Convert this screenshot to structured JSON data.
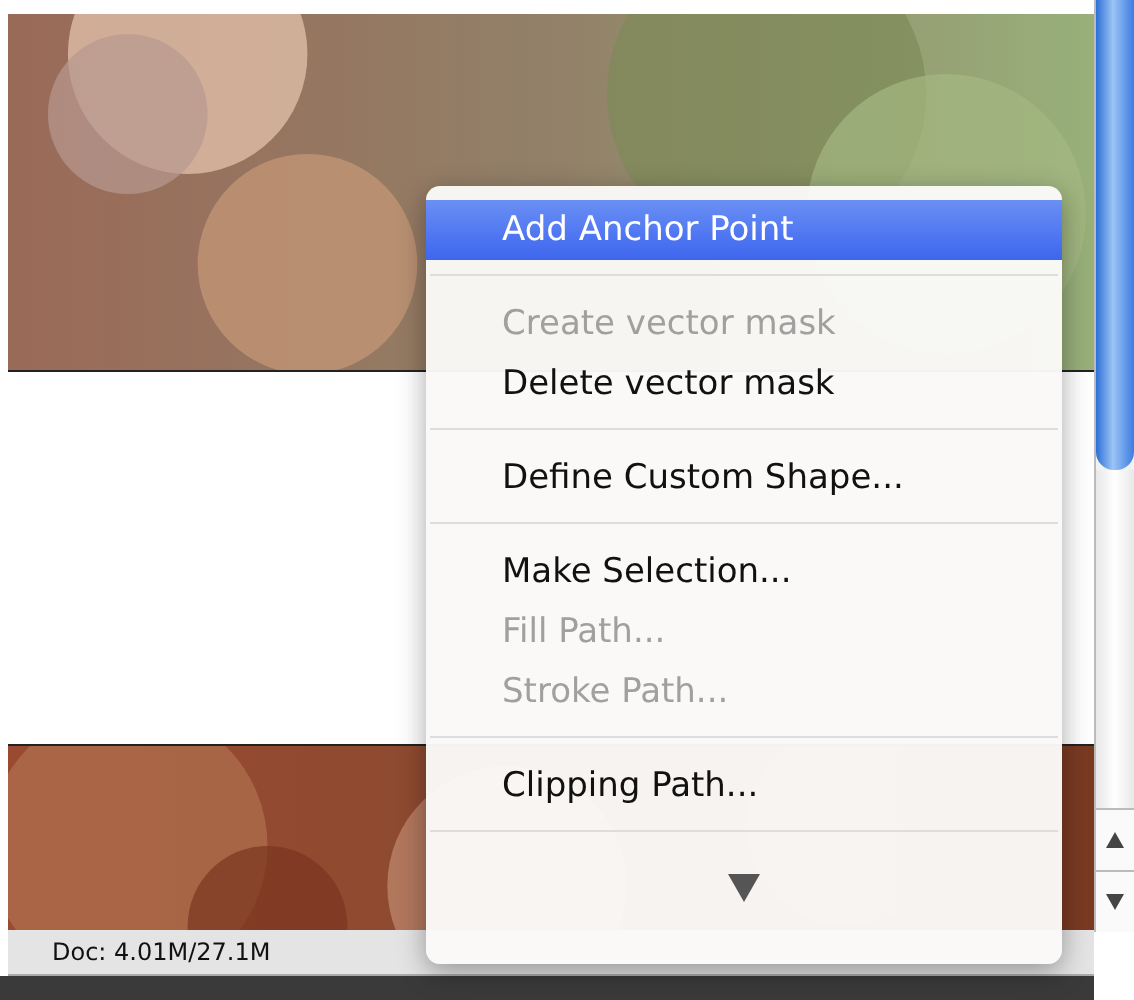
{
  "context_menu": {
    "items": [
      {
        "kind": "item",
        "label": "Add Anchor Point",
        "selected": true,
        "disabled": false
      },
      {
        "kind": "separator"
      },
      {
        "kind": "item",
        "label": "Create vector mask",
        "selected": false,
        "disabled": true
      },
      {
        "kind": "item",
        "label": "Delete vector mask",
        "selected": false,
        "disabled": false
      },
      {
        "kind": "separator"
      },
      {
        "kind": "item",
        "label": "Define Custom Shape...",
        "selected": false,
        "disabled": false
      },
      {
        "kind": "separator"
      },
      {
        "kind": "item",
        "label": "Make Selection...",
        "selected": false,
        "disabled": false
      },
      {
        "kind": "item",
        "label": "Fill Path...",
        "selected": false,
        "disabled": true
      },
      {
        "kind": "item",
        "label": "Stroke Path...",
        "selected": false,
        "disabled": true
      },
      {
        "kind": "separator"
      },
      {
        "kind": "item",
        "label": "Clipping Path...",
        "selected": false,
        "disabled": false
      },
      {
        "kind": "separator"
      },
      {
        "kind": "scroll"
      }
    ]
  },
  "status_bar": {
    "doc_size": "Doc: 4.01M/27.1M"
  }
}
